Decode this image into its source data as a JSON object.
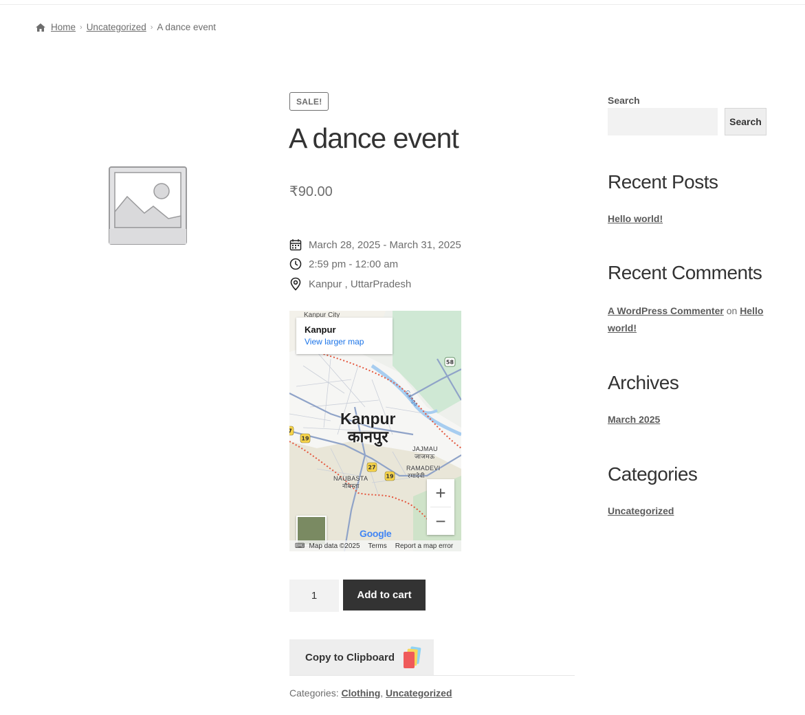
{
  "breadcrumb": {
    "home": "Home",
    "category": "Uncategorized",
    "current": "A dance event"
  },
  "product": {
    "badge": "SALE!",
    "title": "A dance event",
    "price": "₹90.00",
    "date": "March 28, 2025 - March 31, 2025",
    "time": "2:59 pm - 12:00 am",
    "location": "Kanpur , UttarPradesh"
  },
  "map": {
    "card_title": "Kanpur",
    "card_link": "View larger map",
    "city_label_en": "Kanpur",
    "city_label_hi": "कानपुर",
    "top_label": "Kanpur City",
    "labels": [
      "JAJMAU",
      "जाजमऊ",
      "RAMADEVI",
      "रमादेवी",
      "NAUBASTA",
      "नौबस्ता",
      "Ganga"
    ],
    "road_shields": [
      "19",
      "27",
      "19",
      "58",
      "7"
    ],
    "google": "Google",
    "footer": [
      "Map data ©2025",
      "Terms",
      "Report a map error"
    ],
    "zoom_in": "+",
    "zoom_out": "−"
  },
  "cart": {
    "quantity": "1",
    "add_to_cart": "Add to cart"
  },
  "clipboard": {
    "label": "Copy to Clipboard"
  },
  "categories": {
    "label": "Categories: ",
    "items": [
      "Clothing",
      "Uncategorized"
    ],
    "separator": ", "
  },
  "sidebar": {
    "search_label": "Search",
    "search_button": "Search",
    "recent_posts_title": "Recent Posts",
    "recent_posts": [
      "Hello world!"
    ],
    "recent_comments_title": "Recent Comments",
    "comment_author": "A WordPress Commenter",
    "comment_on": " on ",
    "comment_post": "Hello world!",
    "archives_title": "Archives",
    "archives": [
      "March 2025"
    ],
    "categories_title": "Categories",
    "categories": [
      "Uncategorized"
    ]
  },
  "colors": {
    "text": "#6d6d6d",
    "heading": "#333333",
    "button_dark": "#333333",
    "map_link": "#1a73e8"
  }
}
